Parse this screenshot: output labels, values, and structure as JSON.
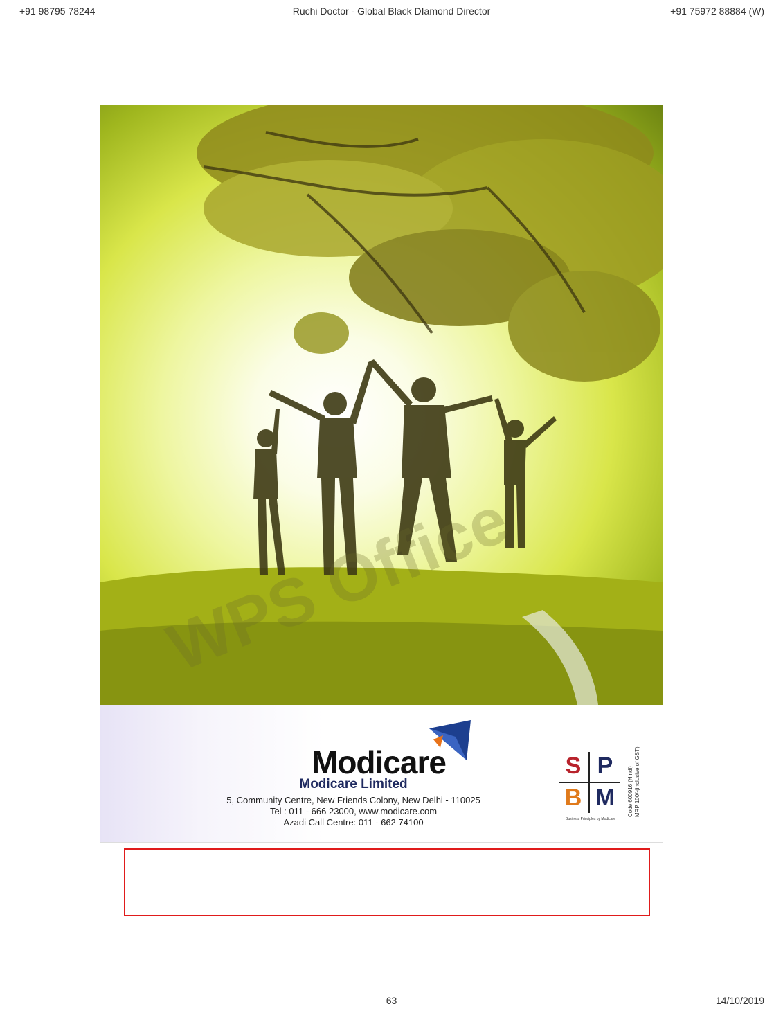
{
  "header": {
    "left_phone": "+91 98795 78244",
    "center_title": "Ruchi Doctor - Global Black DIamond Director",
    "right_phone": "+91 75972 88884 (W)"
  },
  "watermark": "WPS Office",
  "brand": {
    "wordmark": "Modicare",
    "company": "Modicare Limited",
    "address_line1": "5, Community Centre, New Friends Colony, New Delhi - 110025",
    "address_line2": "Tel : 011 - 666 23000, www.modicare.com",
    "address_line3": "Azadi Call Centre: 011 - 662 74100",
    "logo_colors": {
      "kite_blue": "#1d3f8f",
      "kite_orange": "#e8731a"
    }
  },
  "spbm": {
    "letters": [
      "S",
      "P",
      "B",
      "M"
    ],
    "tagline": "Business Principles by Modicare"
  },
  "side_code": {
    "line1": "Code 600916 (Hindi)",
    "line2": "MRP 100/-(inclusive of GST)"
  },
  "footer": {
    "page_number": "63",
    "date": "14/10/2019"
  }
}
